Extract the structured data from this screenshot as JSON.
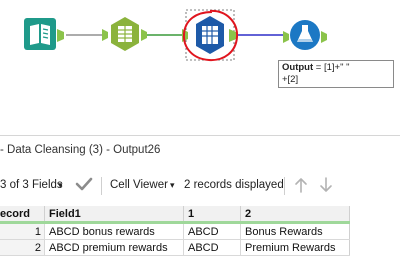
{
  "workflow": {
    "tools": [
      {
        "name": "input-tool"
      },
      {
        "name": "text-to-columns-tool"
      },
      {
        "name": "data-cleansing-tool"
      },
      {
        "name": "formula-tool"
      }
    ],
    "selected_tool": "data-cleansing-tool",
    "annotation": {
      "label": "Output",
      "formula_line1": " = [1]+\" \"",
      "formula_line2": "+[2]"
    },
    "colors": {
      "connection_green": "#3a9a3a",
      "connection_blue": "#2f2fc8",
      "highlight_circle": "#e0151e",
      "input_icon": "#1f9a8a",
      "text_to_columns_icon": "#8bb33c",
      "data_cleansing_icon": "#1e5aa8",
      "formula_icon": "#1c78c4"
    }
  },
  "results": {
    "title": "- Data Cleansing (3) - Output26",
    "toolbar": {
      "fields_label": "3 of 3 Fields",
      "fields_caret": "▾",
      "check_icon": "check-icon",
      "viewer_label": "Cell Viewer",
      "viewer_caret": "▾",
      "records_label": "2 records displayed",
      "up_icon": "arrow-up-icon",
      "down_icon": "arrow-down-icon"
    },
    "columns": [
      "ecord",
      "Field1",
      "1",
      "2"
    ],
    "rows": [
      {
        "record": "1",
        "field1": "ABCD bonus rewards",
        "c1": "ABCD",
        "c2": "Bonus Rewards"
      },
      {
        "record": "2",
        "field1": "ABCD premium rewards",
        "c1": "ABCD",
        "c2": "Premium Rewards"
      }
    ],
    "colors": {
      "header_underline": "#9fd89a",
      "header_bg": "#f1f1f1"
    }
  }
}
